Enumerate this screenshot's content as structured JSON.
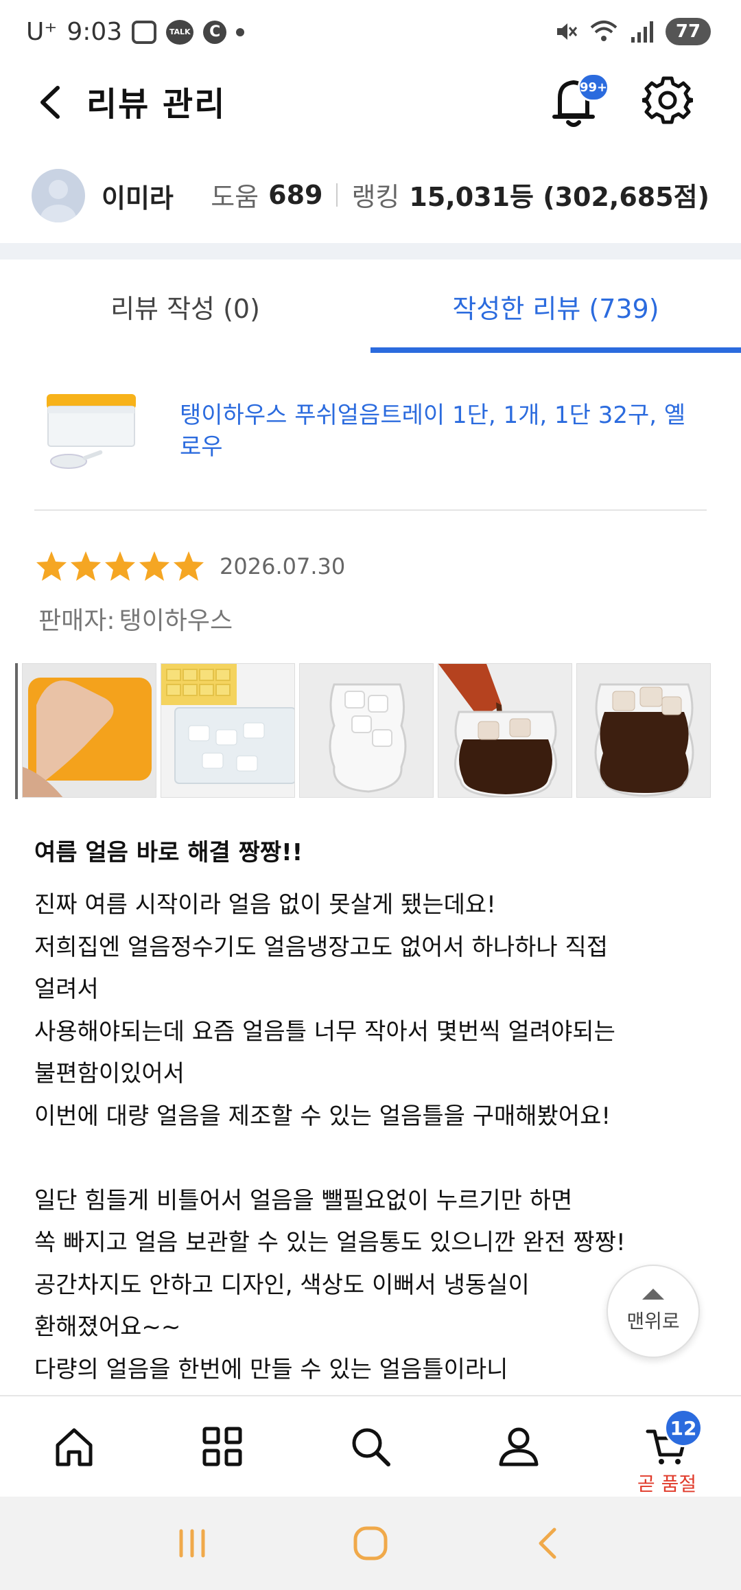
{
  "status_bar": {
    "carrier": "U⁺",
    "time": "9:03",
    "talk_badge": "TALK",
    "c_badge": "C",
    "battery": "77"
  },
  "header": {
    "title": "리뷰 관리",
    "notification_badge": "99+"
  },
  "profile": {
    "name": "이미라",
    "help_label": "도움",
    "help_value": "689",
    "ranking_label": "랭킹",
    "ranking_value": "15,031등 (302,685점)"
  },
  "tabs": [
    {
      "label": "리뷰 작성 (0)",
      "active": false
    },
    {
      "label": "작성한 리뷰 (739)",
      "active": true
    }
  ],
  "product": {
    "name": "탱이하우스 푸쉬얼음트레이 1단, 1개, 1단 32구, 옐로우"
  },
  "review": {
    "rating": 5,
    "date": "2026.07.30",
    "seller_label": "판매자:",
    "seller_name": "탱이하우스",
    "photos": [
      "orange-tray-hand",
      "yellow-tray-ice",
      "glass-ice",
      "pouring-cola",
      "cola-glass"
    ],
    "headline": "여름 얼음 바로 해결 짱짱!!",
    "lines": [
      "진짜 여름 시작이라 얼음 없이 못살게 됐는데요!",
      "저희집엔 얼음정수기도 얼음냉장고도 없어서 하나하나 직접",
      "얼려서",
      "사용해야되는데 요즘 얼음틀 너무 작아서 몇번씩 얼려야되는",
      "불편함이있어서",
      "이번에 대량 얼음을 제조할 수 있는 얼음틀을 구매해봤어요!",
      "",
      "일단 힘들게 비틀어서 얼음을 뺄필요없이 누르기만 하면",
      "쏙 빠지고 얼음 보관할 수 있는 얼음통도 있으니깐 완전 짱짱!",
      "공간차지도 안하고 디자인, 색상도 이뻐서 냉동실이",
      "환해졌어요~~",
      "다량의 얼음을 한번에 만들 수 있는 얼음틀이라니"
    ]
  },
  "scroll_top_label": "맨위로",
  "bottom_nav": {
    "items": [
      "home-icon",
      "grid-icon",
      "search-icon",
      "person-icon",
      "cart-icon"
    ],
    "cart_count": "12",
    "cart_sub": "곧 품절"
  },
  "colors": {
    "accent": "#2b6bde",
    "star": "#f5a623",
    "soldout": "#e03a2a"
  }
}
